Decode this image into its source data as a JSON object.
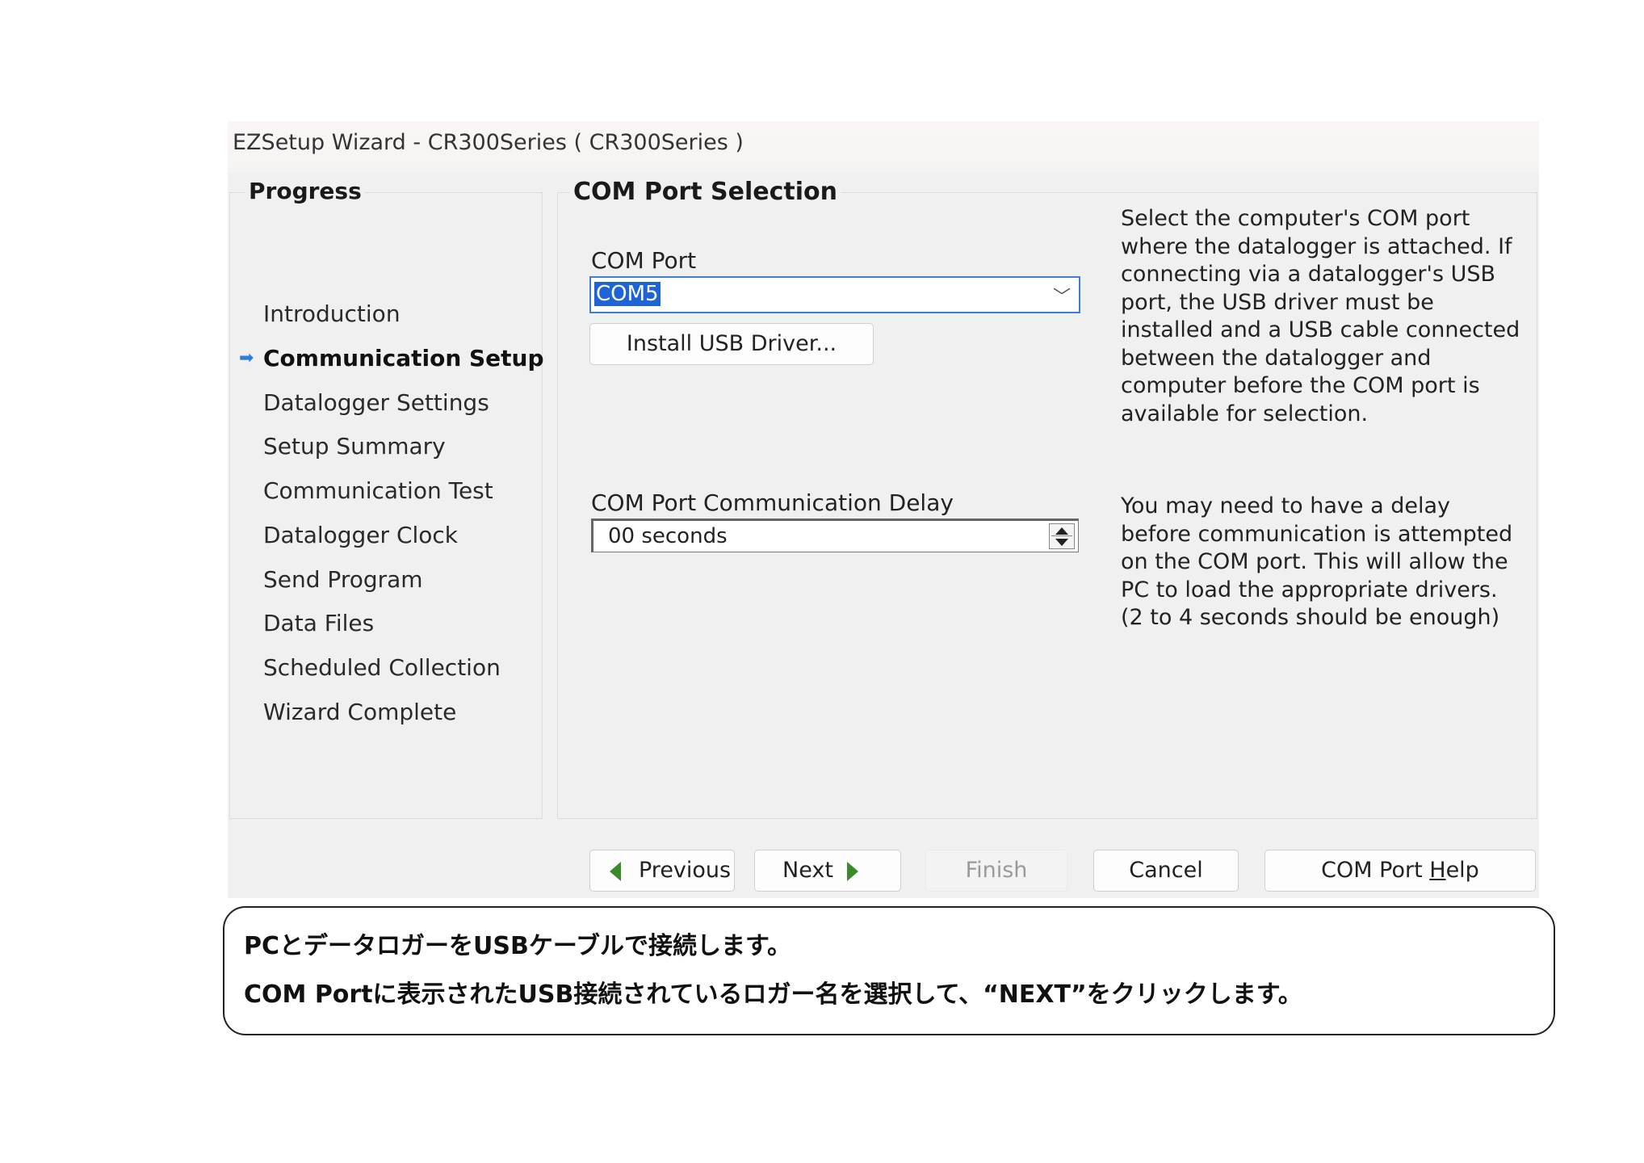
{
  "window": {
    "title": "EZSetup Wizard - CR300Series ( CR300Series )"
  },
  "progress": {
    "title": "Progress",
    "steps": [
      "Introduction",
      "Communication Setup",
      "Datalogger Settings",
      "Setup Summary",
      "Communication Test",
      "Datalogger Clock",
      "Send Program",
      "Data Files",
      "Scheduled Collection",
      "Wizard Complete"
    ],
    "current_index": 1,
    "current_marker_icon": "arrow-right-icon"
  },
  "section": {
    "title": "COM Port Selection"
  },
  "com_port": {
    "label": "COM Port",
    "value": "COM5",
    "install_button": "Install USB Driver...",
    "help_text": "Select the computer's COM port where the datalogger is attached.  If connecting via a datalogger's USB port, the USB driver must be installed and a USB cable connected between the datalogger and computer before the COM port is available for selection."
  },
  "delay": {
    "label": "COM Port Communication Delay",
    "value": "00 seconds",
    "help_text": "You may need to have a delay before communication is attempted on the COM port.  This will allow the PC to load the appropriate drivers. (2 to 4 seconds should be enough)"
  },
  "buttons": {
    "previous": "Previous",
    "next": "Next",
    "finish": "Finish",
    "cancel": "Cancel",
    "help_prefix": "COM Port ",
    "help_mnemonic": "H",
    "help_suffix": "elp"
  },
  "note": {
    "line1": "PCとデータロガーをUSBケーブルで接続します。",
    "line2": "COM Portに表示されたUSB接続されているロガー名を選択して、“NEXT”をクリックします。"
  },
  "colors": {
    "accent": "#1e64d6",
    "window_bg": "#f0f0f0",
    "nav_arrow": "#3a8a2a"
  }
}
